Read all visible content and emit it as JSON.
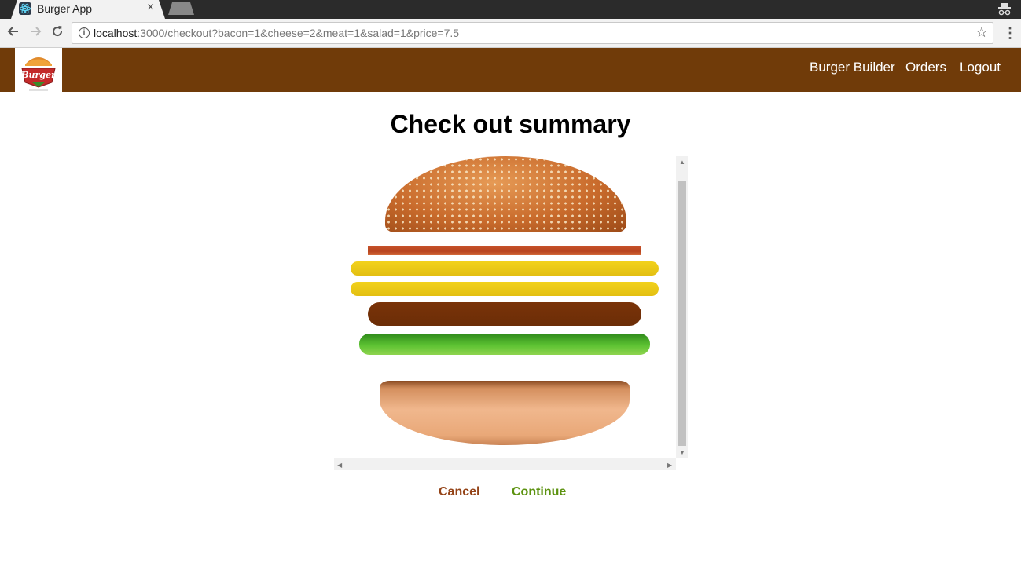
{
  "browser": {
    "tab_title": "Burger App",
    "tab_close": "×",
    "url_host": "localhost",
    "url_rest": ":3000/checkout?bacon=1&cheese=2&meat=1&salad=1&price=7.5",
    "icons": [
      "react-favicon-icon",
      "back-arrow-icon",
      "forward-arrow-icon",
      "reload-icon",
      "info-icon",
      "bookmark-star-icon",
      "menu-dots-icon",
      "incognito-icon"
    ]
  },
  "header": {
    "logo_text": "Burger",
    "nav": {
      "burger_builder": "Burger Builder",
      "orders": "Orders",
      "logout": "Logout"
    },
    "background_color": "#703b09"
  },
  "main": {
    "title": "Check out summary",
    "ingredients": [
      "bacon",
      "cheese",
      "cheese",
      "meat",
      "salad"
    ],
    "cancel_label": "Cancel",
    "continue_label": "Continue",
    "cancel_color": "#944317",
    "continue_color": "#5c9210"
  }
}
